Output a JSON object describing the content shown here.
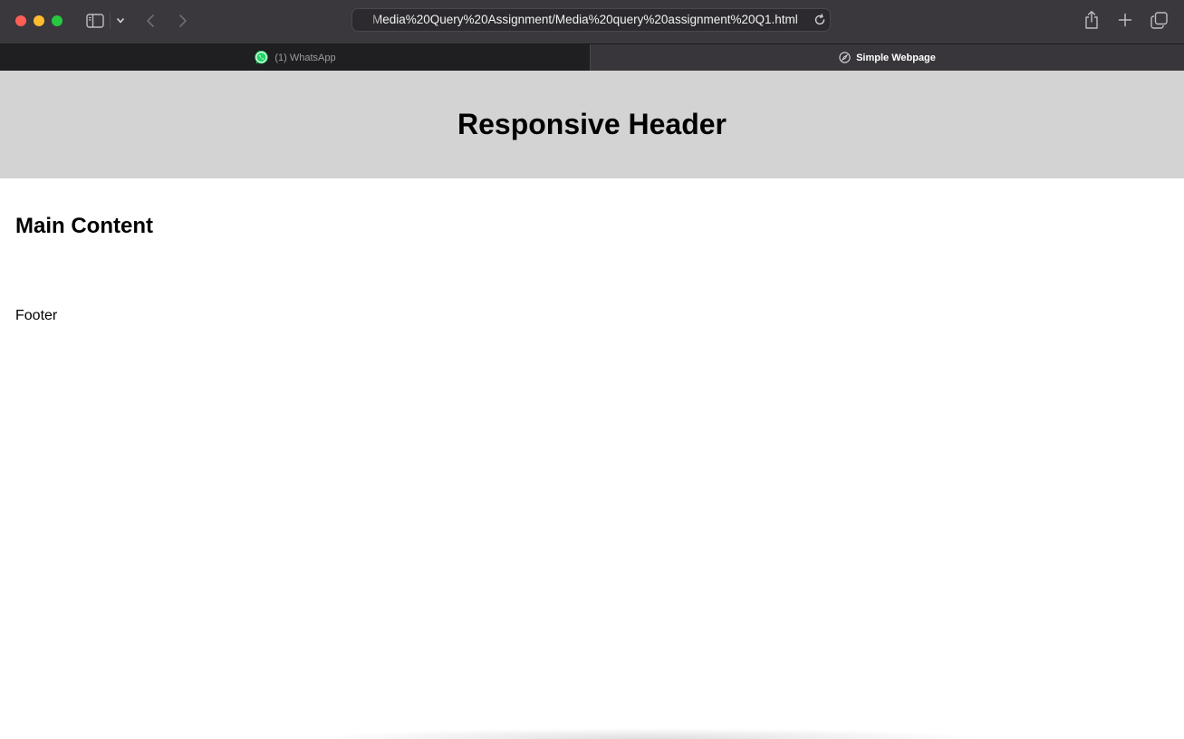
{
  "browser": {
    "address_text": "Media%20Query%20Assignment/Media%20query%20assignment%20Q1.html",
    "tabs": [
      {
        "label": "(1) WhatsApp",
        "icon": "whatsapp-icon",
        "active": false
      },
      {
        "label": "Simple Webpage",
        "icon": "compass-icon",
        "active": true
      }
    ]
  },
  "page": {
    "header_title": "Responsive Header",
    "main_heading": "Main Content",
    "footer_text": "Footer"
  },
  "colors": {
    "header_background": "#d3d3d3",
    "toolbar_background": "#3a383d",
    "whatsapp_green": "#25d366"
  }
}
